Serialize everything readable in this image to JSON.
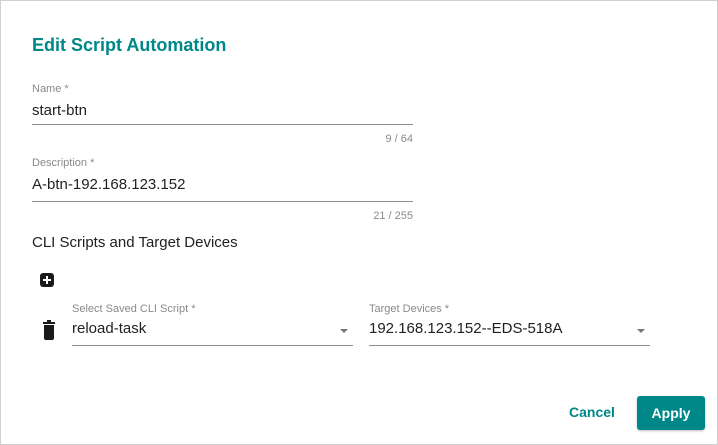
{
  "dialog": {
    "title": "Edit Script Automation"
  },
  "name_field": {
    "label": "Name *",
    "value": "start-btn",
    "counter": "9 / 64"
  },
  "description_field": {
    "label": "Description *",
    "value": "A-btn-192.168.123.152",
    "counter": "21 / 255"
  },
  "section": {
    "heading": "CLI Scripts and Target Devices"
  },
  "icons": {
    "add": "plus-square-icon",
    "delete": "trash-icon",
    "dropdown": "caret-down-icon"
  },
  "script_select": {
    "label": "Select Saved CLI Script *",
    "value": "reload-task"
  },
  "devices_select": {
    "label": "Target Devices *",
    "value": "192.168.123.152--EDS-518A"
  },
  "actions": {
    "cancel_label": "Cancel",
    "apply_label": "Apply"
  },
  "colors": {
    "accent": "#008787",
    "text": "#212121",
    "muted": "#8a8a8a"
  }
}
